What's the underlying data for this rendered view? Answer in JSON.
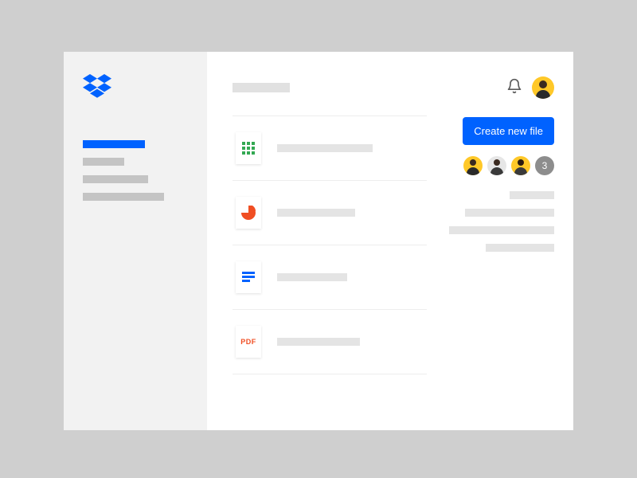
{
  "brand": {
    "name": "Dropbox",
    "logo_color": "#0062ff"
  },
  "sidebar": {
    "items": [
      {
        "active": true,
        "color": "#0062ff",
        "width": 78
      },
      {
        "active": false,
        "color": "#c4c4c4",
        "width": 52
      },
      {
        "active": false,
        "color": "#c4c4c4",
        "width": 82
      },
      {
        "active": false,
        "color": "#c4c4c4",
        "width": 102
      }
    ]
  },
  "header": {
    "title_placeholder_width": 72,
    "notifications_icon": "bell-icon"
  },
  "files": [
    {
      "type": "spreadsheet",
      "icon_color": "#33a852",
      "placeholder_width": 120
    },
    {
      "type": "presentation",
      "icon_color": "#f04e23",
      "placeholder_width": 98
    },
    {
      "type": "document",
      "icon_color": "#0062ff",
      "placeholder_width": 88
    },
    {
      "type": "pdf",
      "icon_color": "#f04e23",
      "icon_label": "PDF",
      "placeholder_width": 104
    }
  ],
  "actions": {
    "create_button_label": "Create new file"
  },
  "collaborators": {
    "avatars": [
      {
        "bg": "#ffc828"
      },
      {
        "bg": "#e6e6e6"
      },
      {
        "bg": "#ffc828"
      }
    ],
    "more_count": "3"
  },
  "info_panel": {
    "lines": [
      56,
      112,
      132,
      86
    ]
  }
}
